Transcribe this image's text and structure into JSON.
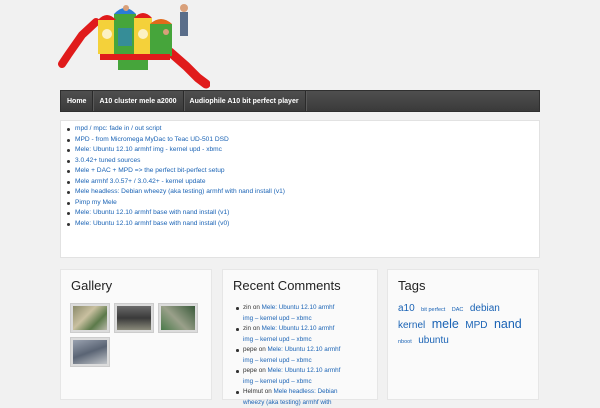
{
  "nav": {
    "items": [
      {
        "label": "Home"
      },
      {
        "label": "A10 cluster mele a2000"
      },
      {
        "label": "Audiophile A10 bit perfect player"
      }
    ]
  },
  "posts": [
    "mpd / mpc: fade in / out script",
    "MPD - from Micromega MyDac to Teac UD-501 DSD",
    "Mele: Ubuntu 12.10 armhf img - kernel upd - xbmc",
    "3.0.42+ tuned sources",
    "Mele + DAC + MPD => the perfect bit-perfect setup",
    "Mele armhf 3.0.57+ / 3.0.42+ - kernel update",
    "Mele headless: Debian wheezy (aka testing) armhf with nand install (v1)",
    "Pimp my Mele",
    "Mele: Ubuntu 12.10 armhf base with nand install (v1)",
    "Mele: Ubuntu 12.10 armhf base with nand install (v0)"
  ],
  "gallery": {
    "title": "Gallery"
  },
  "comments": {
    "title": "Recent Comments",
    "items": [
      {
        "author": "zin",
        "on": "on",
        "post_line1": "Mele: Ubuntu 12.10 armhf",
        "post_line2": "img – kernel upd – xbmc"
      },
      {
        "author": "zin",
        "on": "on",
        "post_line1": "Mele: Ubuntu 12.10 armhf",
        "post_line2": "img – kernel upd – xbmc"
      },
      {
        "author": "pepe",
        "on": "on",
        "post_line1": "Mele: Ubuntu 12.10 armhf",
        "post_line2": "img – kernel upd – xbmc"
      },
      {
        "author": "pepe",
        "on": "on",
        "post_line1": "Mele: Ubuntu 12.10 armhf",
        "post_line2": "img – kernel upd – xbmc"
      },
      {
        "author": "Helmut",
        "on": "on",
        "post_line1": "Mele headless: Debian",
        "post_line2": "wheezy (aka testing) armhf with"
      }
    ]
  },
  "tags": {
    "title": "Tags",
    "items": [
      {
        "label": "a10",
        "size": "large"
      },
      {
        "label": "bit perfect",
        "size": "small"
      },
      {
        "label": "DAC",
        "size": "small"
      },
      {
        "label": "debian",
        "size": "large"
      },
      {
        "label": "kernel",
        "size": "large"
      },
      {
        "label": "mele",
        "size": "xlarge"
      },
      {
        "label": "MPD",
        "size": "large"
      },
      {
        "label": "nand",
        "size": "xlarge"
      },
      {
        "label": "nboot",
        "size": "small"
      },
      {
        "label": "ubuntu",
        "size": "large"
      }
    ]
  },
  "colors": {
    "link": "#1a63b5",
    "nav_bg": "#444444",
    "page_bg": "#f1f1f1"
  },
  "icons": {
    "logo": "playground-slide-illustration"
  }
}
